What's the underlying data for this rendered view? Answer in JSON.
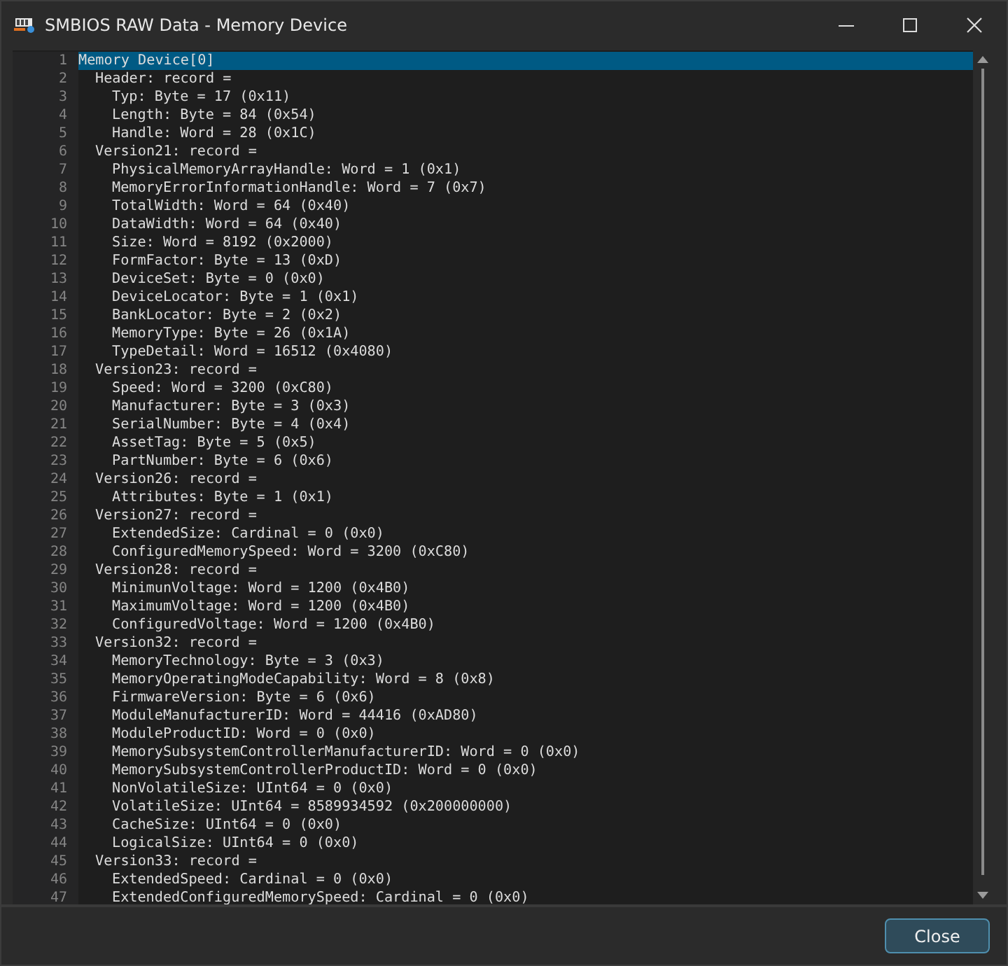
{
  "window": {
    "title": "SMBIOS RAW Data - Memory Device"
  },
  "lines": [
    {
      "number": "1",
      "text": "Memory Device[0]",
      "selected": true,
      "children": [
        {
          "number": "2",
          "text": "Header: record =",
          "selected": false,
          "children": [
            {
              "number": "3",
              "text": "Typ: Byte = 17 (0x11)",
              "selected": false
            },
            {
              "number": "4",
              "text": "Length: Byte = 84 (0x54)",
              "selected": false
            },
            {
              "number": "5",
              "text": "Handle: Word = 28 (0x1C)",
              "selected": false
            }
          ]
        },
        {
          "number": "6",
          "text": "Version21: record =",
          "selected": false,
          "children": [
            {
              "number": "7",
              "text": "PhysicalMemoryArrayHandle: Word = 1 (0x1)",
              "selected": false
            },
            {
              "number": "8",
              "text": "MemoryErrorInformationHandle: Word = 7 (0x7)",
              "selected": false
            },
            {
              "number": "9",
              "text": "TotalWidth: Word = 64 (0x40)",
              "selected": false
            },
            {
              "number": "10",
              "text": "DataWidth: Word = 64 (0x40)",
              "selected": false
            },
            {
              "number": "11",
              "text": "Size: Word = 8192 (0x2000)",
              "selected": false
            },
            {
              "number": "12",
              "text": "FormFactor: Byte = 13 (0xD)",
              "selected": false
            },
            {
              "number": "13",
              "text": "DeviceSet: Byte = 0 (0x0)",
              "selected": false
            },
            {
              "number": "14",
              "text": "DeviceLocator: Byte = 1 (0x1)",
              "selected": false
            },
            {
              "number": "15",
              "text": "BankLocator: Byte = 2 (0x2)",
              "selected": false
            },
            {
              "number": "16",
              "text": "MemoryType: Byte = 26 (0x1A)",
              "selected": false
            },
            {
              "number": "17",
              "text": "TypeDetail: Word = 16512 (0x4080)",
              "selected": false
            }
          ]
        },
        {
          "number": "18",
          "text": "Version23: record =",
          "selected": false,
          "children": [
            {
              "number": "19",
              "text": "Speed: Word = 3200 (0xC80)",
              "selected": false
            },
            {
              "number": "20",
              "text": "Manufacturer: Byte = 3 (0x3)",
              "selected": false
            },
            {
              "number": "21",
              "text": "SerialNumber: Byte = 4 (0x4)",
              "selected": false
            },
            {
              "number": "22",
              "text": "AssetTag: Byte = 5 (0x5)",
              "selected": false
            },
            {
              "number": "23",
              "text": "PartNumber: Byte = 6 (0x6)",
              "selected": false
            }
          ]
        },
        {
          "number": "24",
          "text": "Version26: record =",
          "selected": false,
          "children": [
            {
              "number": "25",
              "text": "Attributes: Byte = 1 (0x1)",
              "selected": false
            }
          ]
        },
        {
          "number": "26",
          "text": "Version27: record =",
          "selected": false,
          "children": [
            {
              "number": "27",
              "text": "ExtendedSize: Cardinal = 0 (0x0)",
              "selected": false
            },
            {
              "number": "28",
              "text": "ConfiguredMemorySpeed: Word = 3200 (0xC80)",
              "selected": false
            }
          ]
        },
        {
          "number": "29",
          "text": "Version28: record =",
          "selected": false,
          "children": [
            {
              "number": "30",
              "text": "MinimunVoltage: Word = 1200 (0x4B0)",
              "selected": false
            },
            {
              "number": "31",
              "text": "MaximumVoltage: Word = 1200 (0x4B0)",
              "selected": false
            },
            {
              "number": "32",
              "text": "ConfiguredVoltage: Word = 1200 (0x4B0)",
              "selected": false
            }
          ]
        },
        {
          "number": "33",
          "text": "Version32: record =",
          "selected": false,
          "children": [
            {
              "number": "34",
              "text": "MemoryTechnology: Byte = 3 (0x3)",
              "selected": false
            },
            {
              "number": "35",
              "text": "MemoryOperatingModeCapability: Word = 8 (0x8)",
              "selected": false
            },
            {
              "number": "36",
              "text": "FirmwareVersion: Byte = 6 (0x6)",
              "selected": false
            },
            {
              "number": "37",
              "text": "ModuleManufacturerID: Word = 44416 (0xAD80)",
              "selected": false
            },
            {
              "number": "38",
              "text": "ModuleProductID: Word = 0 (0x0)",
              "selected": false
            },
            {
              "number": "39",
              "text": "MemorySubsystemControllerManufacturerID: Word = 0 (0x0)",
              "selected": false
            },
            {
              "number": "40",
              "text": "MemorySubsystemControllerProductID: Word = 0 (0x0)",
              "selected": false
            },
            {
              "number": "41",
              "text": "NonVolatileSize: UInt64 = 0 (0x0)",
              "selected": false
            },
            {
              "number": "42",
              "text": "VolatileSize: UInt64 = 8589934592 (0x200000000)",
              "selected": false
            },
            {
              "number": "43",
              "text": "CacheSize: UInt64 = 0 (0x0)",
              "selected": false
            },
            {
              "number": "44",
              "text": "LogicalSize: UInt64 = 0 (0x0)",
              "selected": false
            }
          ]
        },
        {
          "number": "45",
          "text": "Version33: record =",
          "selected": false,
          "children": [
            {
              "number": "46",
              "text": "ExtendedSpeed: Cardinal = 0 (0x0)",
              "selected": false
            },
            {
              "number": "47",
              "text": "ExtendedConfiguredMemorySpeed: Cardinal = 0 (0x0)",
              "selected": false
            }
          ]
        }
      ]
    }
  ],
  "buttons": [
    {
      "label": "Close"
    }
  ]
}
